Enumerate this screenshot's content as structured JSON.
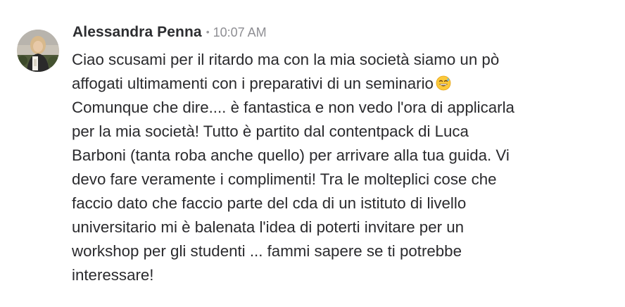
{
  "message": {
    "author": "Alessandra Penna",
    "separator": "•",
    "time": "10:07 AM",
    "avatar_icon": "user-avatar-photo",
    "emoji_icon": "grinning-face-with-sweat-emoji",
    "lines": [
      "Ciao scusami per il ritardo ma con la mia società siamo un pò",
      "affogati ultimamenti con i preparativi di un seminario",
      "Comunque che dire.... è fantastica e non vedo l'ora di applicarla",
      "per la mia società! Tutto è partito dal contentpack di Luca",
      "Barboni (tanta roba anche quello) per arrivare alla tua guida. Vi",
      "devo fare veramente i complimenti! Tra le molteplici cose che",
      "faccio dato che faccio parte del cda di un istituto di livello",
      "universitario mi è balenata l'idea di poterti invitare per un",
      "workshop per gli studenti ... fammi sapere se ti potrebbe",
      "interessare!"
    ]
  }
}
